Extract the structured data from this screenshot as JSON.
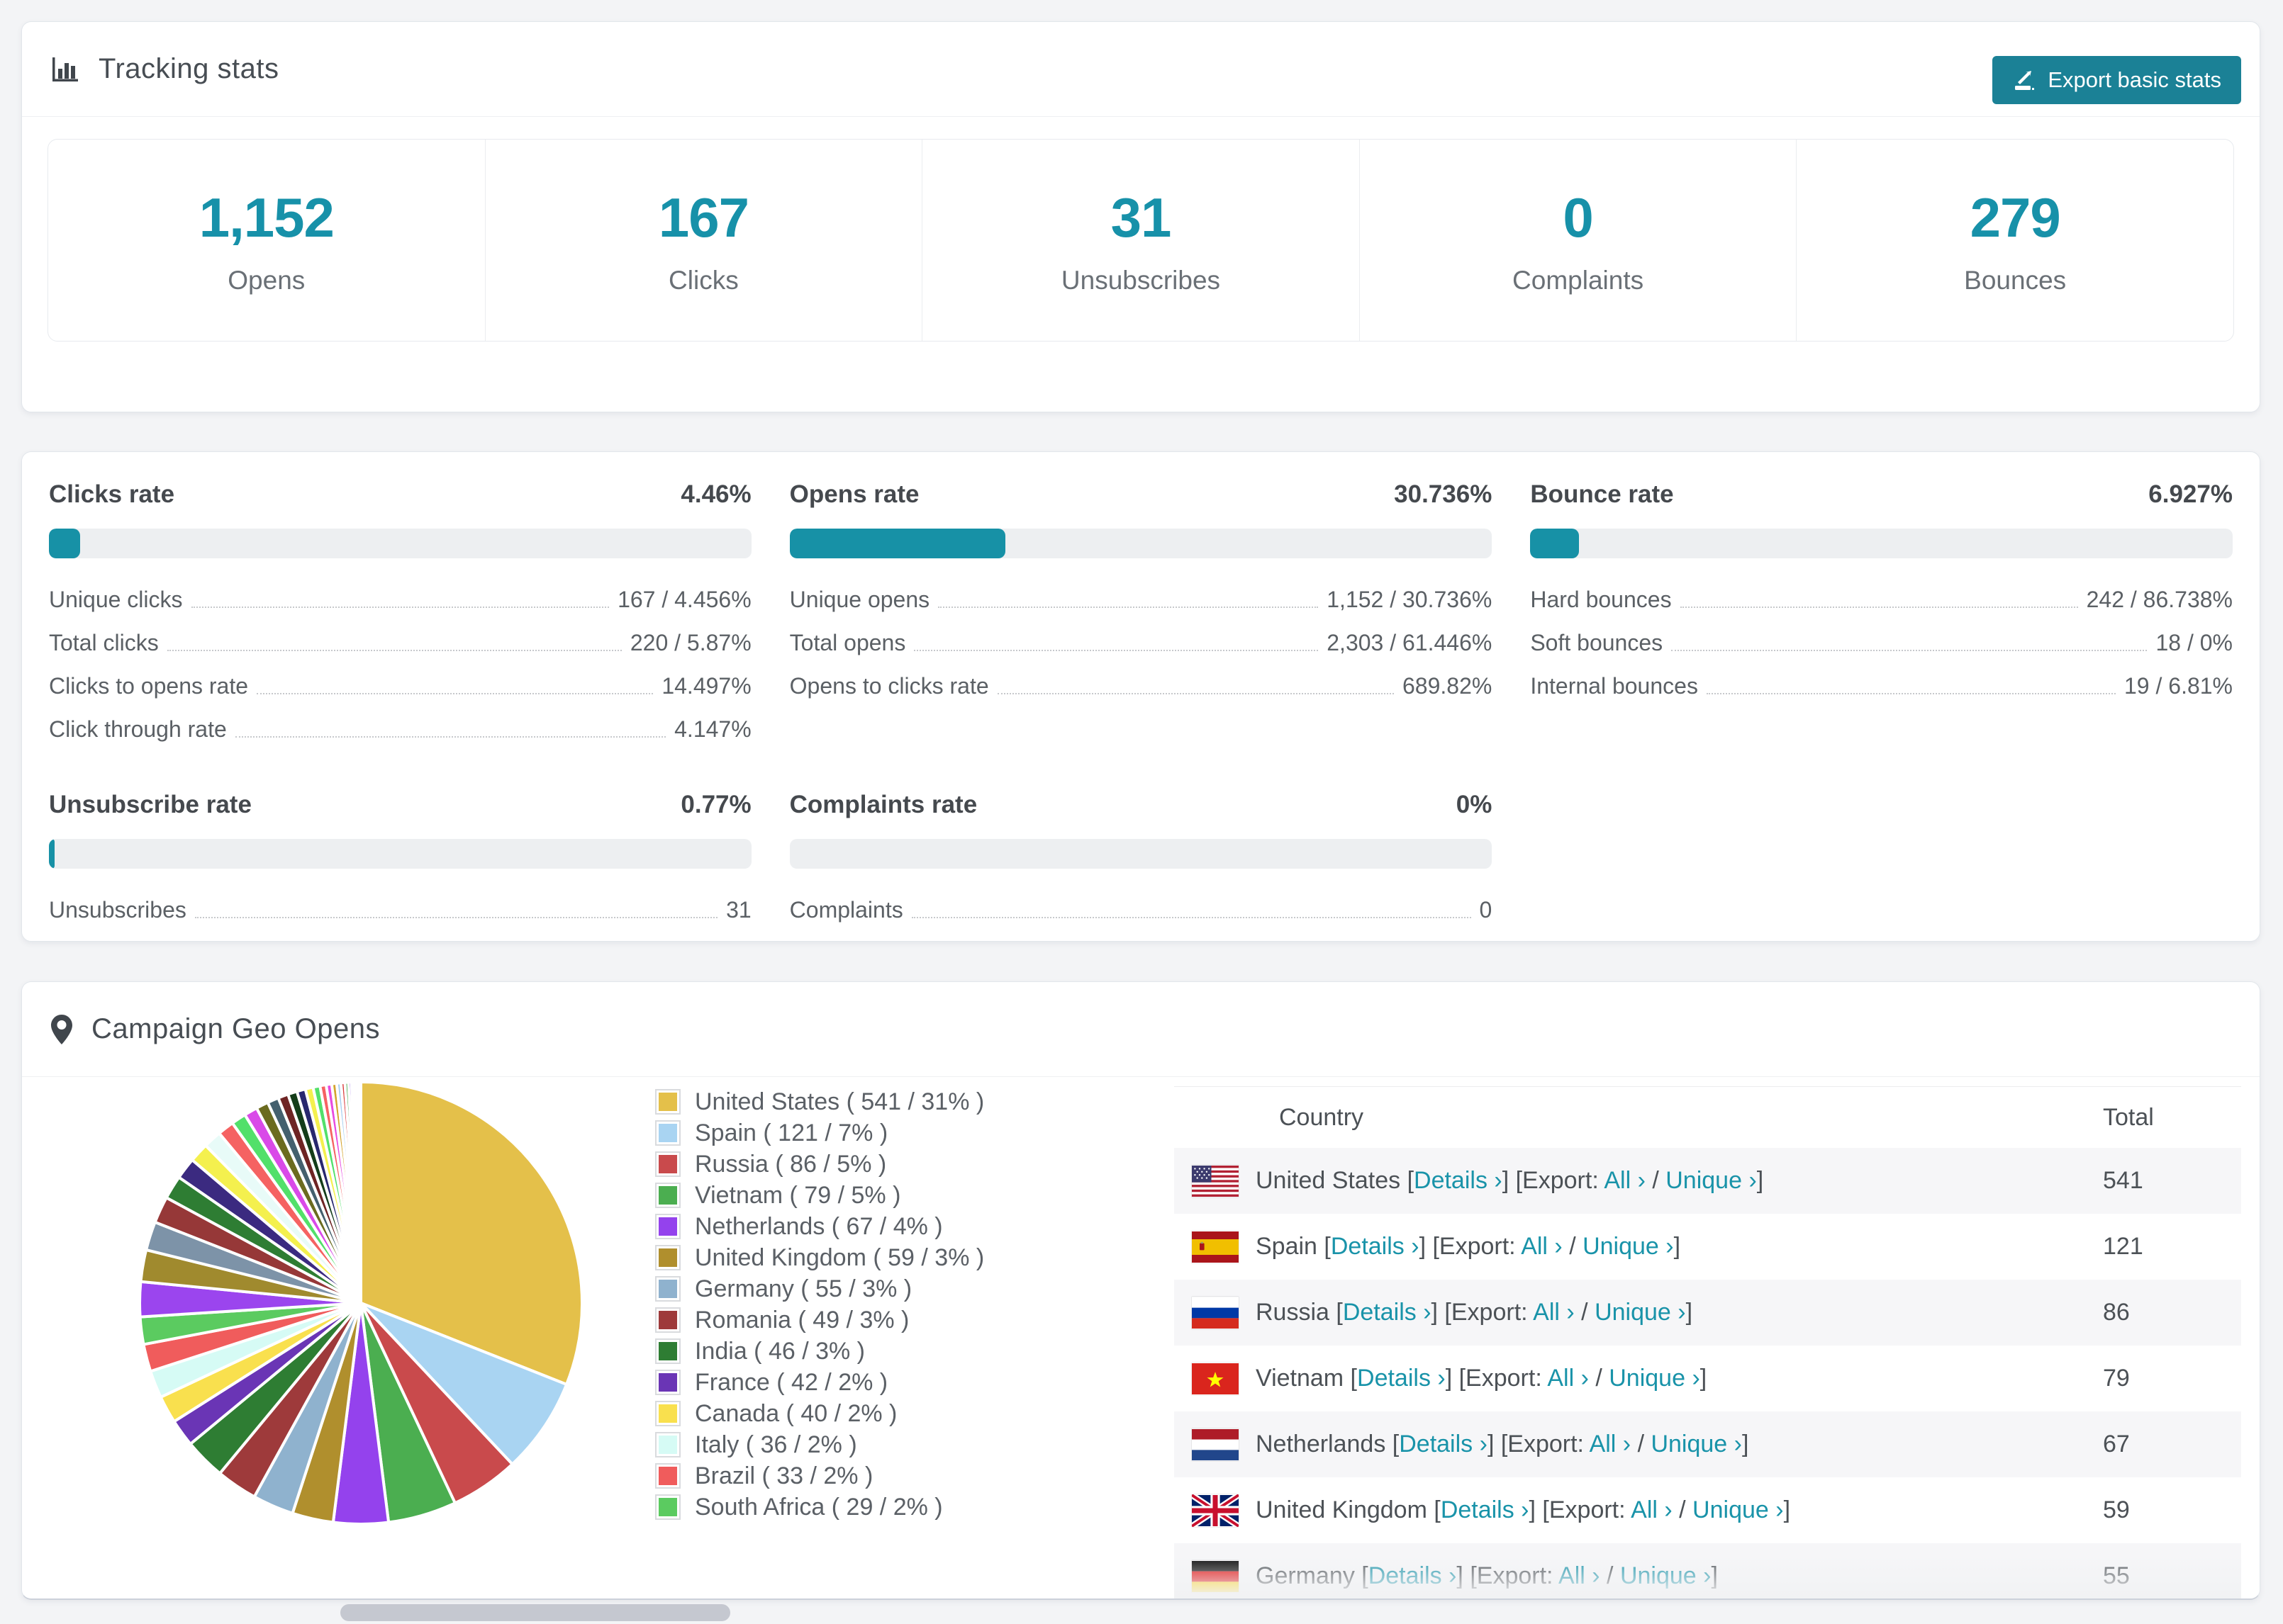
{
  "accent": {
    "teal": "#1791a9",
    "button_bg": "#1b8196",
    "link": "#1993a9"
  },
  "tracking": {
    "title": "Tracking stats",
    "export_button": "Export basic stats",
    "stats": [
      {
        "value": "1,152",
        "label": "Opens"
      },
      {
        "value": "167",
        "label": "Clicks"
      },
      {
        "value": "31",
        "label": "Unsubscribes"
      },
      {
        "value": "0",
        "label": "Complaints"
      },
      {
        "value": "279",
        "label": "Bounces"
      }
    ]
  },
  "rates": {
    "blocks": [
      {
        "title": "Clicks rate",
        "value": "4.46%",
        "percent": 4.46,
        "rows": [
          {
            "label": "Unique clicks",
            "value": "167 / 4.456%"
          },
          {
            "label": "Total clicks",
            "value": "220 / 5.87%"
          },
          {
            "label": "Clicks to opens rate",
            "value": "14.497%"
          },
          {
            "label": "Click through rate",
            "value": "4.147%"
          }
        ]
      },
      {
        "title": "Opens rate",
        "value": "30.736%",
        "percent": 30.736,
        "rows": [
          {
            "label": "Unique opens",
            "value": "1,152 / 30.736%"
          },
          {
            "label": "Total opens",
            "value": "2,303 / 61.446%"
          },
          {
            "label": "Opens to clicks rate",
            "value": "689.82%"
          }
        ]
      },
      {
        "title": "Bounce rate",
        "value": "6.927%",
        "percent": 6.927,
        "rows": [
          {
            "label": "Hard bounces",
            "value": "242 / 86.738%"
          },
          {
            "label": "Soft bounces",
            "value": "18 / 0%"
          },
          {
            "label": "Internal bounces",
            "value": "19 / 6.81%"
          }
        ]
      },
      {
        "title": "Unsubscribe rate",
        "value": "0.77%",
        "percent": 0.77,
        "rows": [
          {
            "label": "Unsubscribes",
            "value": "31"
          }
        ]
      },
      {
        "title": "Complaints rate",
        "value": "0%",
        "percent": 0,
        "rows": [
          {
            "label": "Complaints",
            "value": "0"
          }
        ]
      }
    ]
  },
  "geo": {
    "title": "Campaign Geo Opens",
    "table": {
      "headers": [
        "Country",
        "Total"
      ],
      "link_labels": {
        "details": "Details ›",
        "export_prefix": "Export:",
        "all": "All ›",
        "unique": "Unique ›"
      },
      "punct": {
        "open": "[",
        "close_open": "] [",
        "slash": " / ",
        "close": "]"
      },
      "rows": [
        {
          "country": "United States",
          "flag": "us",
          "total": "541"
        },
        {
          "country": "Spain",
          "flag": "es",
          "total": "121"
        },
        {
          "country": "Russia",
          "flag": "ru",
          "total": "86"
        },
        {
          "country": "Vietnam",
          "flag": "vn",
          "total": "79"
        },
        {
          "country": "Netherlands",
          "flag": "nl",
          "total": "67"
        },
        {
          "country": "United Kingdom",
          "flag": "gb",
          "total": "59"
        },
        {
          "country": "Germany",
          "flag": "de",
          "total": "55"
        }
      ]
    }
  },
  "chart_data": {
    "type": "pie",
    "title": "Campaign Geo Opens",
    "legend_position": "right",
    "labels": [
      "United States",
      "Spain",
      "Russia",
      "Vietnam",
      "Netherlands",
      "United Kingdom",
      "Germany",
      "Romania",
      "India",
      "France",
      "Canada",
      "Italy",
      "Brazil",
      "South Africa"
    ],
    "values": [
      541,
      121,
      86,
      79,
      67,
      59,
      55,
      49,
      46,
      42,
      40,
      36,
      33,
      29
    ],
    "percents": [
      31,
      7,
      5,
      5,
      4,
      3,
      3,
      3,
      3,
      2,
      2,
      2,
      2,
      2
    ],
    "colors": [
      "#E4C04A",
      "#A9D4F2",
      "#C94A4C",
      "#4BAE50",
      "#9442ED",
      "#B08F2D",
      "#8FB2CE",
      "#9E3A3B",
      "#2E7D33",
      "#6A35B5",
      "#F9E04E",
      "#D6FBF5",
      "#F05C5C",
      "#5BCB60"
    ],
    "legend_labels": [
      "United States ( 541 / 31% )",
      "Spain ( 121 / 7% )",
      "Russia ( 86 / 5% )",
      "Vietnam ( 79 / 5% )",
      "Netherlands ( 67 / 4% )",
      "United Kingdom ( 59 / 3% )",
      "Germany ( 55 / 3% )",
      "Romania ( 49 / 3% )",
      "India ( 46 / 3% )",
      "France ( 42 / 2% )",
      "Canada ( 40 / 2% )",
      "Italy ( 36 / 2% )",
      "Brazil ( 33 / 2% )",
      "South Africa ( 29 / 2% )"
    ],
    "other_slices": {
      "total_percent": 26,
      "weights": [
        1.7,
        1.55,
        1.4,
        1.3,
        1.15,
        1.05,
        0.95,
        0.88,
        0.8,
        0.72,
        0.65,
        0.6,
        0.55,
        0.5,
        0.45,
        0.42,
        0.38,
        0.34,
        0.3,
        0.27,
        0.24,
        0.21,
        0.19,
        0.17,
        0.15,
        0.13,
        0.11,
        0.09,
        0.07,
        0.05
      ],
      "colors": [
        "#9B45EE",
        "#A08A2E",
        "#7D93A8",
        "#963838",
        "#2E7D33",
        "#3B2A80",
        "#F4F04E",
        "#E8FBF8",
        "#F56262",
        "#52E06A",
        "#D94AE8",
        "#6B6B1F",
        "#44606E",
        "#6E2424",
        "#143D1A",
        "#28286E",
        "#F4F04E",
        "#52E06A",
        "#F56262",
        "#E84AE0",
        "#D4A42E",
        "#A8D0F0",
        "#D93B3B",
        "#3AA53E",
        "#8A5AE8",
        "#A08A2E",
        "#5A78F0",
        "#9B45EE",
        "#D93B3B",
        "#3AA53E"
      ]
    }
  }
}
